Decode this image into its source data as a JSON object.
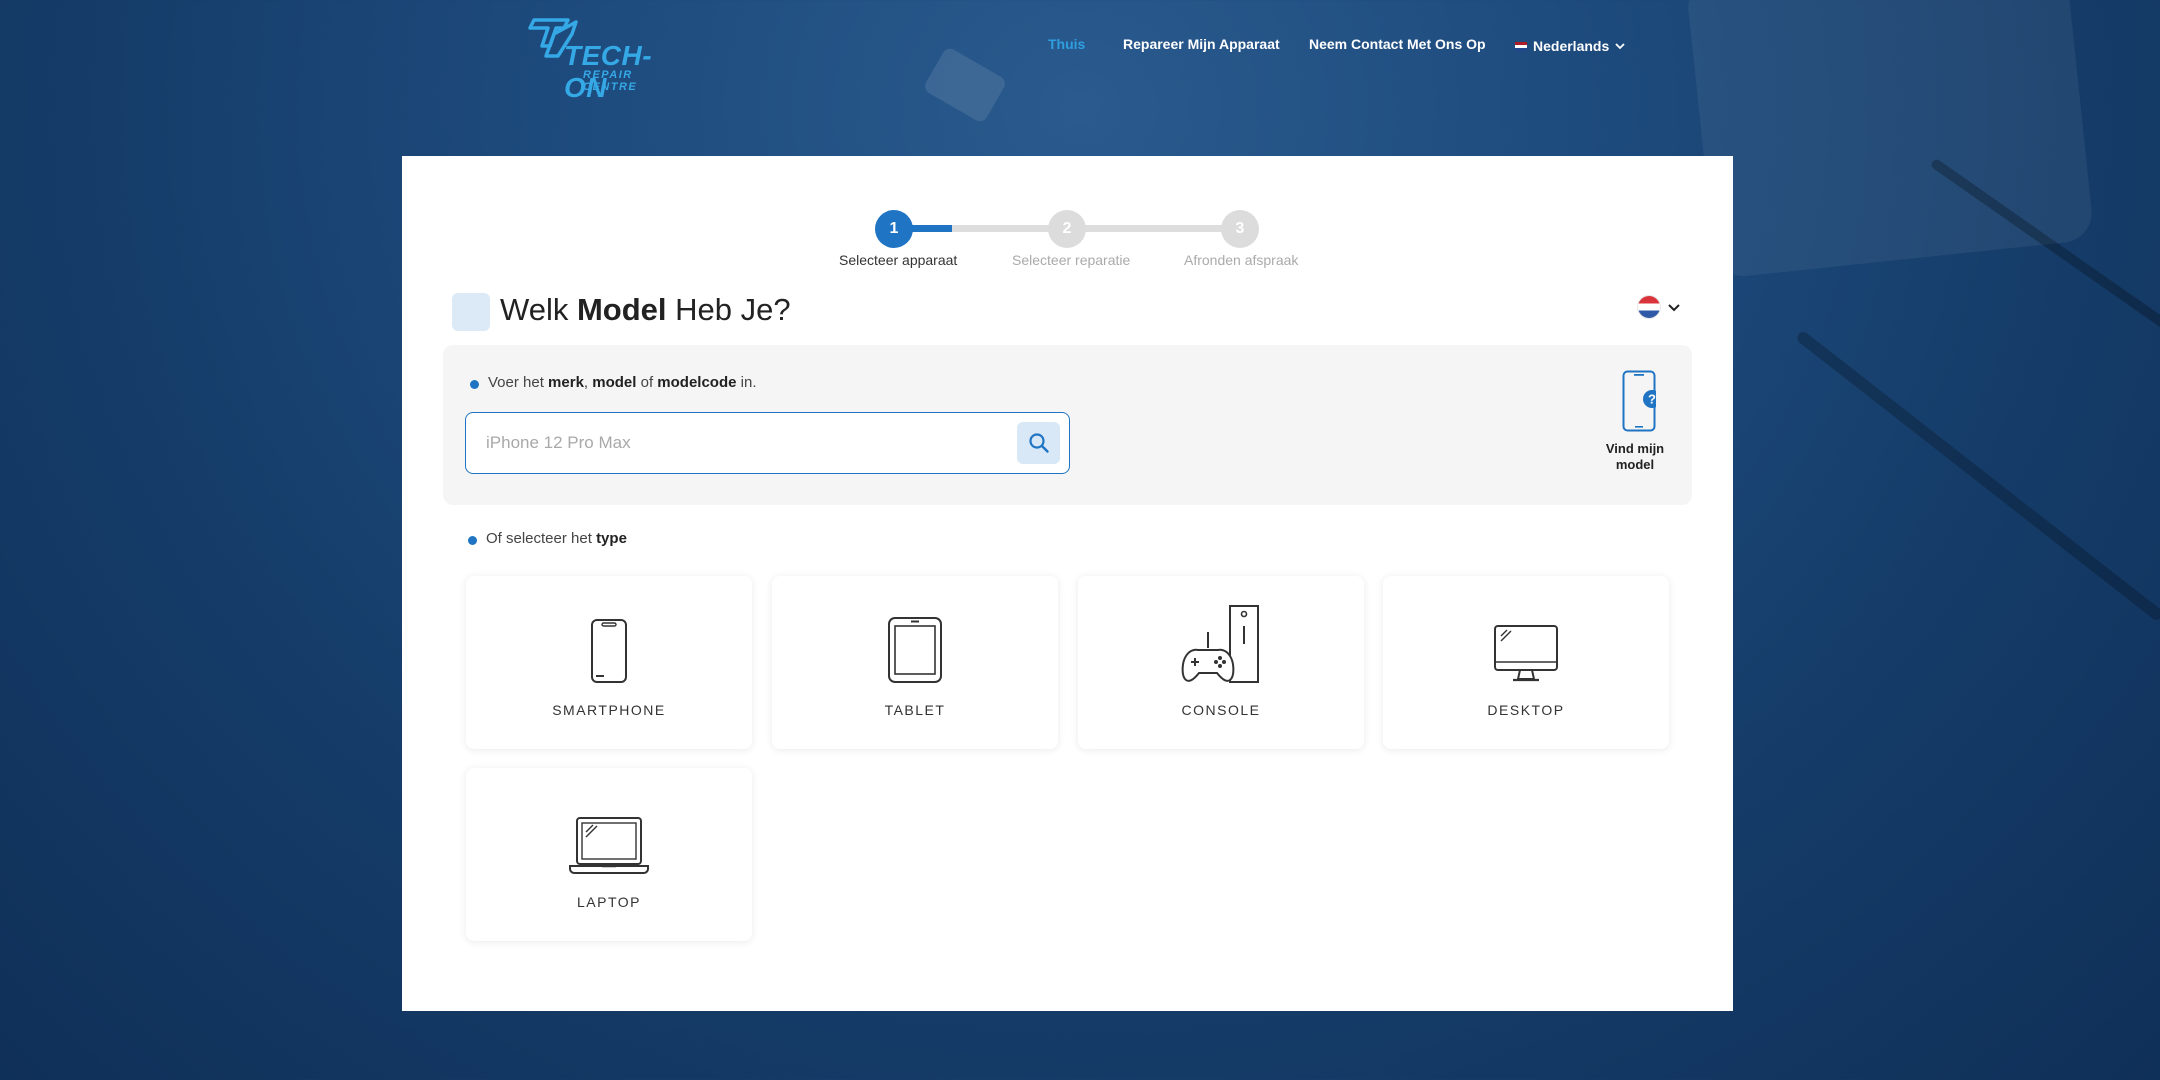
{
  "brand": {
    "name": "TECH-ON",
    "tagline": "REPAIR CENTRE",
    "color": "#35a8e6"
  },
  "nav": {
    "home": "Thuis",
    "repair": "Repareer Mijn Apparaat",
    "contact": "Neem Contact Met Ons Op",
    "language": "Nederlands"
  },
  "stepper": {
    "steps": [
      {
        "number": "1",
        "label": "Selecteer apparaat",
        "active": true
      },
      {
        "number": "2",
        "label": "Selecteer reparatie",
        "active": false
      },
      {
        "number": "3",
        "label": "Afronden afspraak",
        "active": false
      }
    ],
    "progress": 0.33
  },
  "heading": {
    "pre": "Welk ",
    "bold": "Model",
    "post": " Heb Je?"
  },
  "search": {
    "hint_pre": "Voer het ",
    "hint_merk": "merk",
    "hint_sep1": ", ",
    "hint_model": "model",
    "hint_of": " of ",
    "hint_modelcode": "modelcode",
    "hint_post": " in.",
    "placeholder": "iPhone 12 Pro Max",
    "value": ""
  },
  "find_model": {
    "label_line1": "Vind mijn",
    "label_line2": "model"
  },
  "types": {
    "hint_pre": "Of selecteer het ",
    "hint_bold": "type",
    "items": [
      {
        "label": "SMARTPHONE",
        "icon": "smartphone-icon"
      },
      {
        "label": "TABLET",
        "icon": "tablet-icon"
      },
      {
        "label": "CONSOLE",
        "icon": "console-icon"
      },
      {
        "label": "DESKTOP",
        "icon": "desktop-icon"
      },
      {
        "label": "LAPTOP",
        "icon": "laptop-icon"
      }
    ]
  },
  "colors": {
    "accent": "#1f74c4",
    "nav_active": "#2f9fe0",
    "background": "#1d4a7c"
  }
}
